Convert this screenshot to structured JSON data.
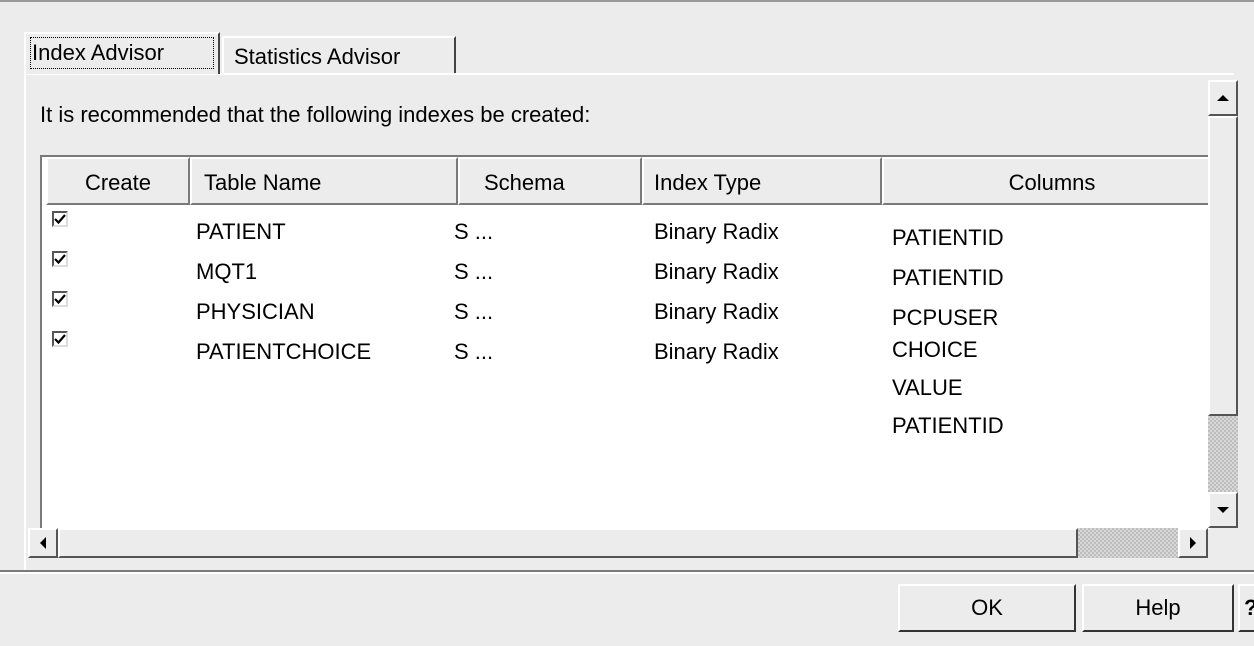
{
  "tabs": [
    {
      "label": "Index Advisor",
      "selected": true
    },
    {
      "label": "Statistics Advisor",
      "selected": false
    }
  ],
  "description": "It is recommended that the following indexes be created:",
  "table": {
    "headers": {
      "create": "Create",
      "table_name": "Table Name",
      "schema": "Schema",
      "index_type": "Index Type",
      "columns": "Columns"
    },
    "rows": [
      {
        "checked": true,
        "table_name": "PATIENT",
        "schema": "S ...",
        "index_type": "Binary Radix",
        "columns": [
          "PATIENTID"
        ]
      },
      {
        "checked": true,
        "table_name": "MQT1",
        "schema": "S ...",
        "index_type": "Binary Radix",
        "columns": [
          "PATIENTID"
        ]
      },
      {
        "checked": true,
        "table_name": "PHYSICIAN",
        "schema": "S ...",
        "index_type": "Binary Radix",
        "columns": [
          "PCPUSER"
        ]
      },
      {
        "checked": true,
        "table_name": "PATIENTCHOICE",
        "schema": "S ...",
        "index_type": "Binary Radix",
        "columns": [
          "CHOICE",
          "VALUE",
          "PATIENTID"
        ]
      }
    ]
  },
  "buttons": {
    "ok": "OK",
    "help": "Help",
    "question": "?"
  },
  "icons": {
    "scroll_up": "arrow-up-icon",
    "scroll_down": "arrow-down-icon",
    "scroll_left": "arrow-left-icon",
    "scroll_right": "arrow-right-icon",
    "checkbox": "checkmark-icon"
  }
}
